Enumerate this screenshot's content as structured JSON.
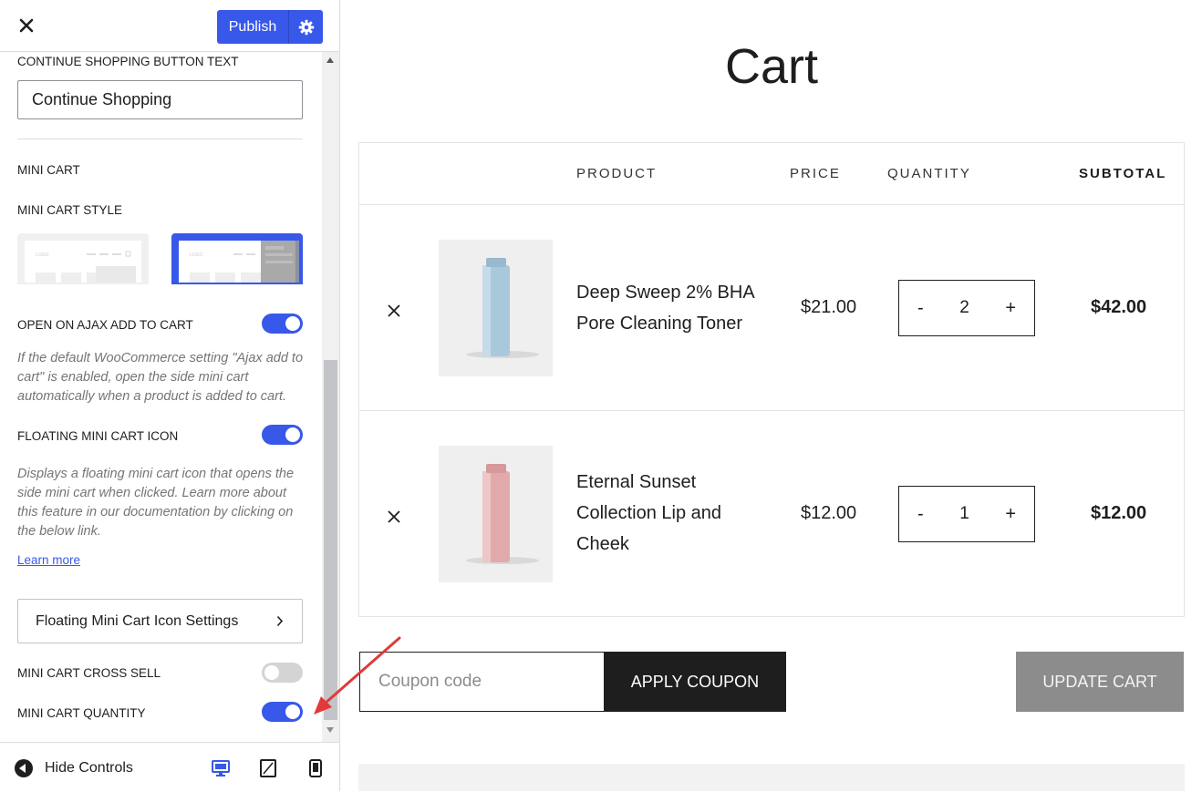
{
  "customizer": {
    "publish_label": "Publish",
    "sections": {
      "continue_label": "CONTINUE SHOPPING BUTTON TEXT",
      "continue_value": "Continue Shopping",
      "mini_cart_heading": "MINI CART",
      "mini_cart_style_label": "MINI CART STYLE",
      "thumb_logo": "LOGO",
      "ajax_label": "OPEN ON AJAX ADD TO CART",
      "ajax_desc": "If the default WooCommerce setting \"Ajax add to cart\" is enabled, open the side mini cart automatically when a product is added to cart.",
      "floating_label": "FLOATING MINI CART ICON",
      "floating_desc": "Displays a floating mini cart icon that opens the side mini cart when clicked. Learn more about this feature in our documentation by clicking on the below link.",
      "learn_more": "Learn more",
      "floating_settings_btn": "Floating Mini Cart Icon Settings",
      "cross_sell_label": "MINI CART CROSS SELL",
      "quantity_label": "MINI CART QUANTITY"
    },
    "toggles": {
      "ajax": true,
      "floating": true,
      "cross_sell": false,
      "quantity": true
    },
    "hide_controls": "Hide Controls"
  },
  "cart": {
    "title": "Cart",
    "headers": {
      "product": "PRODUCT",
      "price": "PRICE",
      "quantity": "QUANTITY",
      "subtotal": "SUBTOTAL"
    },
    "items": [
      {
        "name": "Deep Sweep 2% BHA Pore Cleaning Toner",
        "price": "$21.00",
        "qty": "2",
        "subtotal": "$42.00",
        "bottle_color": "#a9c8dc"
      },
      {
        "name": "Eternal Sunset Collection Lip and Cheek",
        "price": "$12.00",
        "qty": "1",
        "subtotal": "$12.00",
        "bottle_color": "#e2a9ab"
      }
    ],
    "qty_minus": "-",
    "qty_plus": "+",
    "coupon_placeholder": "Coupon code",
    "apply_label": "APPLY COUPON",
    "update_label": "UPDATE CART"
  },
  "colors": {
    "accent": "#3858e9",
    "dark": "#1e1e1e",
    "update_btn": "#8c8c8c",
    "arrow": "#e03b3b"
  }
}
